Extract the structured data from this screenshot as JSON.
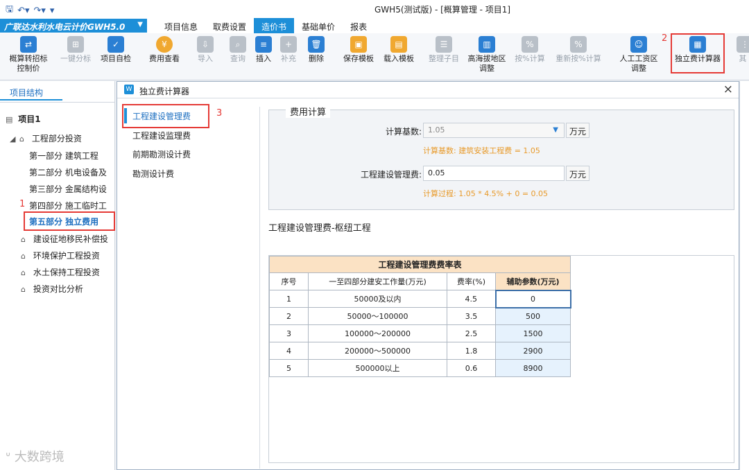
{
  "window": {
    "title": "GWH5(测试版) - [概算管理 - 项目1]"
  },
  "brand": {
    "label": "广联达水利水电云计价GWH5.0"
  },
  "menu_tabs": [
    "项目信息",
    "取费设置",
    "造价书",
    "基础单价",
    "报表"
  ],
  "ribbon": {
    "btn1": "概算转招标",
    "btn1b": "控制价",
    "btn2": "一键分标",
    "btn3": "项目自检",
    "btn4": "费用查看",
    "btn5": "导入",
    "btn6": "查询",
    "btn7": "插入",
    "btn8": "补充",
    "btn9": "删除",
    "btn10": "保存模板",
    "btn11": "载入模板",
    "btn12": "整理子目",
    "btn13": "高海拔地区",
    "btn13b": "调整",
    "btn14": "按%计算",
    "btn15": "重新按%计算",
    "btn16": "人工工资区",
    "btn16b": "调整",
    "btn17": "独立费计算器",
    "btn18": "其"
  },
  "left_panel": {
    "tab": "项目结构",
    "tree": [
      "项目1",
      "工程部分投资",
      "第一部分  建筑工程",
      "第二部分  机电设备及",
      "第三部分  金属结构设",
      "第四部分  施工临时工",
      "第五部分  独立费用",
      "建设征地移民补偿投",
      "环境保护工程投资",
      "水土保持工程投资",
      "投资对比分析"
    ]
  },
  "annotations": {
    "n1": "1",
    "n2": "2",
    "n3": "3"
  },
  "watermark": "大数跨境",
  "dialog": {
    "title": "独立费计算器",
    "nav": [
      "工程建设管理费",
      "工程建设监理费",
      "前期勘测设计费",
      "勘测设计费"
    ],
    "section_title": "费用计算",
    "base_label": "计算基数:",
    "base_value": "1.05",
    "unit": "万元",
    "base_hint": "计算基数:  建筑安装工程费 = 1.05",
    "fee_label": "工程建设管理费:",
    "fee_value": "0.05",
    "process_hint": "计算过程:  1.05 * 4.5% + 0 = 0.05",
    "subtitle": "工程建设管理费-枢纽工程",
    "table": {
      "caption": "工程建设管理费费率表",
      "headers": [
        "序号",
        "一至四部分建安工作量(万元)",
        "费率(%)",
        "辅助参数(万元)"
      ],
      "rows": [
        [
          "1",
          "50000及以内",
          "4.5",
          "0"
        ],
        [
          "2",
          "50000～100000",
          "3.5",
          "500"
        ],
        [
          "3",
          "100000～200000",
          "2.5",
          "1500"
        ],
        [
          "4",
          "200000～500000",
          "1.8",
          "2900"
        ],
        [
          "5",
          "500000以上",
          "0.6",
          "8900"
        ]
      ]
    }
  }
}
